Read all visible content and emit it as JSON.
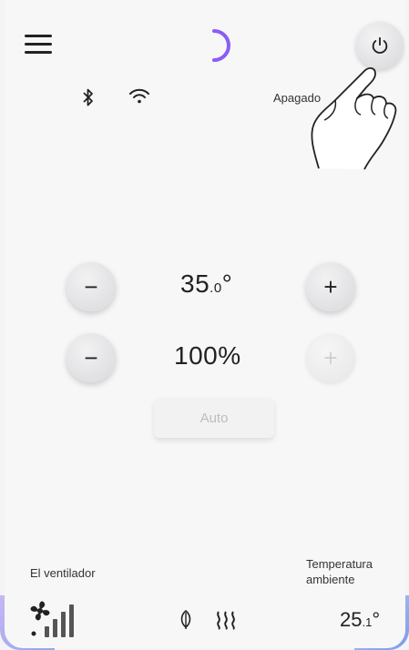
{
  "header": {
    "menu_icon": "hamburger-menu-icon",
    "loading_icon": "loading-spinner-icon",
    "power_icon": "power-icon"
  },
  "status": {
    "bluetooth_icon": "bluetooth-icon",
    "wifi_icon": "wifi-icon",
    "power_state_label": "Apagado"
  },
  "temperature_setpoint": {
    "value_main": "35",
    "value_decimal": ".0",
    "unit": "°",
    "decrease_label": "−",
    "increase_label": "+"
  },
  "fan_speed": {
    "value": "100%",
    "decrease_label": "−",
    "increase_label": "+"
  },
  "auto_button": {
    "label": "Auto"
  },
  "footer": {
    "fan_label": "El ventilador",
    "fan_icon": "fan-speed-icon",
    "eco_icon": "leaf-icon",
    "heat_icon": "heat-waves-icon",
    "ambient_label": "Temperatura ambiente",
    "ambient_value_main": "25",
    "ambient_value_decimal": ".1",
    "ambient_unit": "°"
  },
  "colors": {
    "accent_spinner": "#8b5cf6",
    "text": "#222222",
    "disabled": "#cfcfd2"
  }
}
